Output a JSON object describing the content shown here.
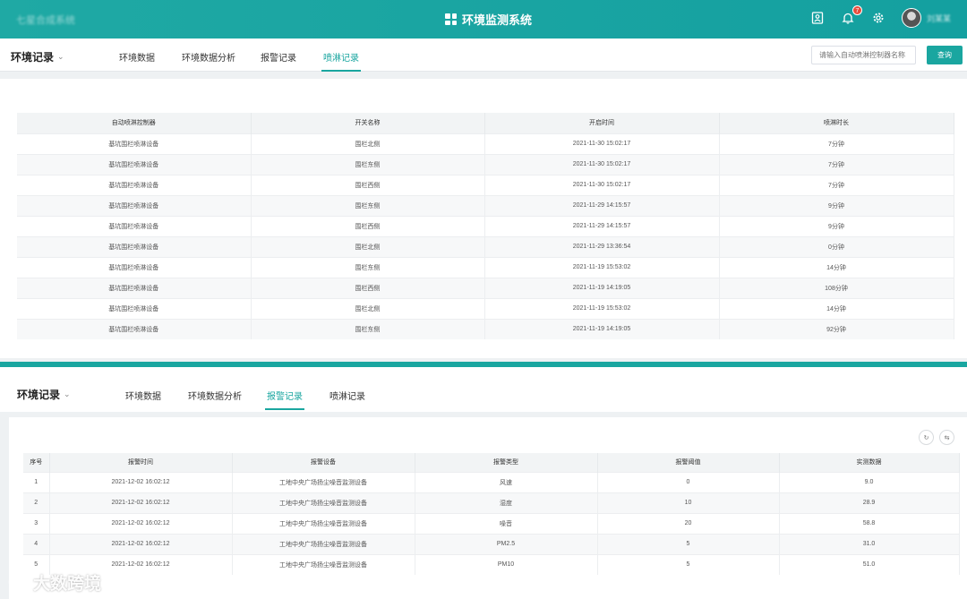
{
  "header": {
    "logo_text": "七星合成系统",
    "app_title": "环境监测系统",
    "notification_count": "7",
    "username": "刘某某"
  },
  "top": {
    "section_title": "环境记录",
    "tabs": [
      "环境数据",
      "环境数据分析",
      "报警记录",
      "喷淋记录"
    ],
    "active_tab": "喷淋记录",
    "search_placeholder": "请输入自动喷淋控制器名称",
    "search_button": "查询",
    "table": {
      "headers": [
        "自动喷淋控制器",
        "开关名称",
        "开启时间",
        "喷淋时长"
      ],
      "rows": [
        [
          "基坑围栏喷淋设备",
          "围栏北侧",
          "2021-11-30 15:02:17",
          "7分钟"
        ],
        [
          "基坑围栏喷淋设备",
          "围栏东侧",
          "2021-11-30 15:02:17",
          "7分钟"
        ],
        [
          "基坑围栏喷淋设备",
          "围栏西侧",
          "2021-11-30 15:02:17",
          "7分钟"
        ],
        [
          "基坑围栏喷淋设备",
          "围栏东侧",
          "2021-11-29 14:15:57",
          "9分钟"
        ],
        [
          "基坑围栏喷淋设备",
          "围栏西侧",
          "2021-11-29 14:15:57",
          "9分钟"
        ],
        [
          "基坑围栏喷淋设备",
          "围栏北侧",
          "2021-11-29 13:36:54",
          "0分钟"
        ],
        [
          "基坑围栏喷淋设备",
          "围栏东侧",
          "2021-11-19 15:53:02",
          "14分钟"
        ],
        [
          "基坑围栏喷淋设备",
          "围栏西侧",
          "2021-11-19 14:19:05",
          "108分钟"
        ],
        [
          "基坑围栏喷淋设备",
          "围栏北侧",
          "2021-11-19 15:53:02",
          "14分钟"
        ],
        [
          "基坑围栏喷淋设备",
          "围栏东侧",
          "2021-11-19 14:19:05",
          "92分钟"
        ]
      ]
    }
  },
  "bottom": {
    "section_title": "环境记录",
    "tabs": [
      "环境数据",
      "环境数据分析",
      "报警记录",
      "喷淋记录"
    ],
    "active_tab": "报警记录",
    "table": {
      "headers": [
        "序号",
        "报警时间",
        "报警设备",
        "报警类型",
        "报警阈值",
        "实测数据"
      ],
      "rows": [
        [
          "1",
          "2021-12-02 16:02:12",
          "工地中央广场扬尘噪音监测设备",
          "风速",
          "0",
          "9.0"
        ],
        [
          "2",
          "2021-12-02 16:02:12",
          "工地中央广场扬尘噪音监测设备",
          "湿度",
          "10",
          "28.9"
        ],
        [
          "3",
          "2021-12-02 16:02:12",
          "工地中央广场扬尘噪音监测设备",
          "噪音",
          "20",
          "58.8"
        ],
        [
          "4",
          "2021-12-02 16:02:12",
          "工地中央广场扬尘噪音监测设备",
          "PM2.5",
          "5",
          "31.0"
        ],
        [
          "5",
          "2021-12-02 16:02:12",
          "工地中央广场扬尘噪音监测设备",
          "PM10",
          "5",
          "51.0"
        ]
      ]
    }
  },
  "watermark": "大数跨境",
  "colors": {
    "accent": "#1aa6a0",
    "header": "#17a5a2",
    "badge": "#e74c3c"
  }
}
